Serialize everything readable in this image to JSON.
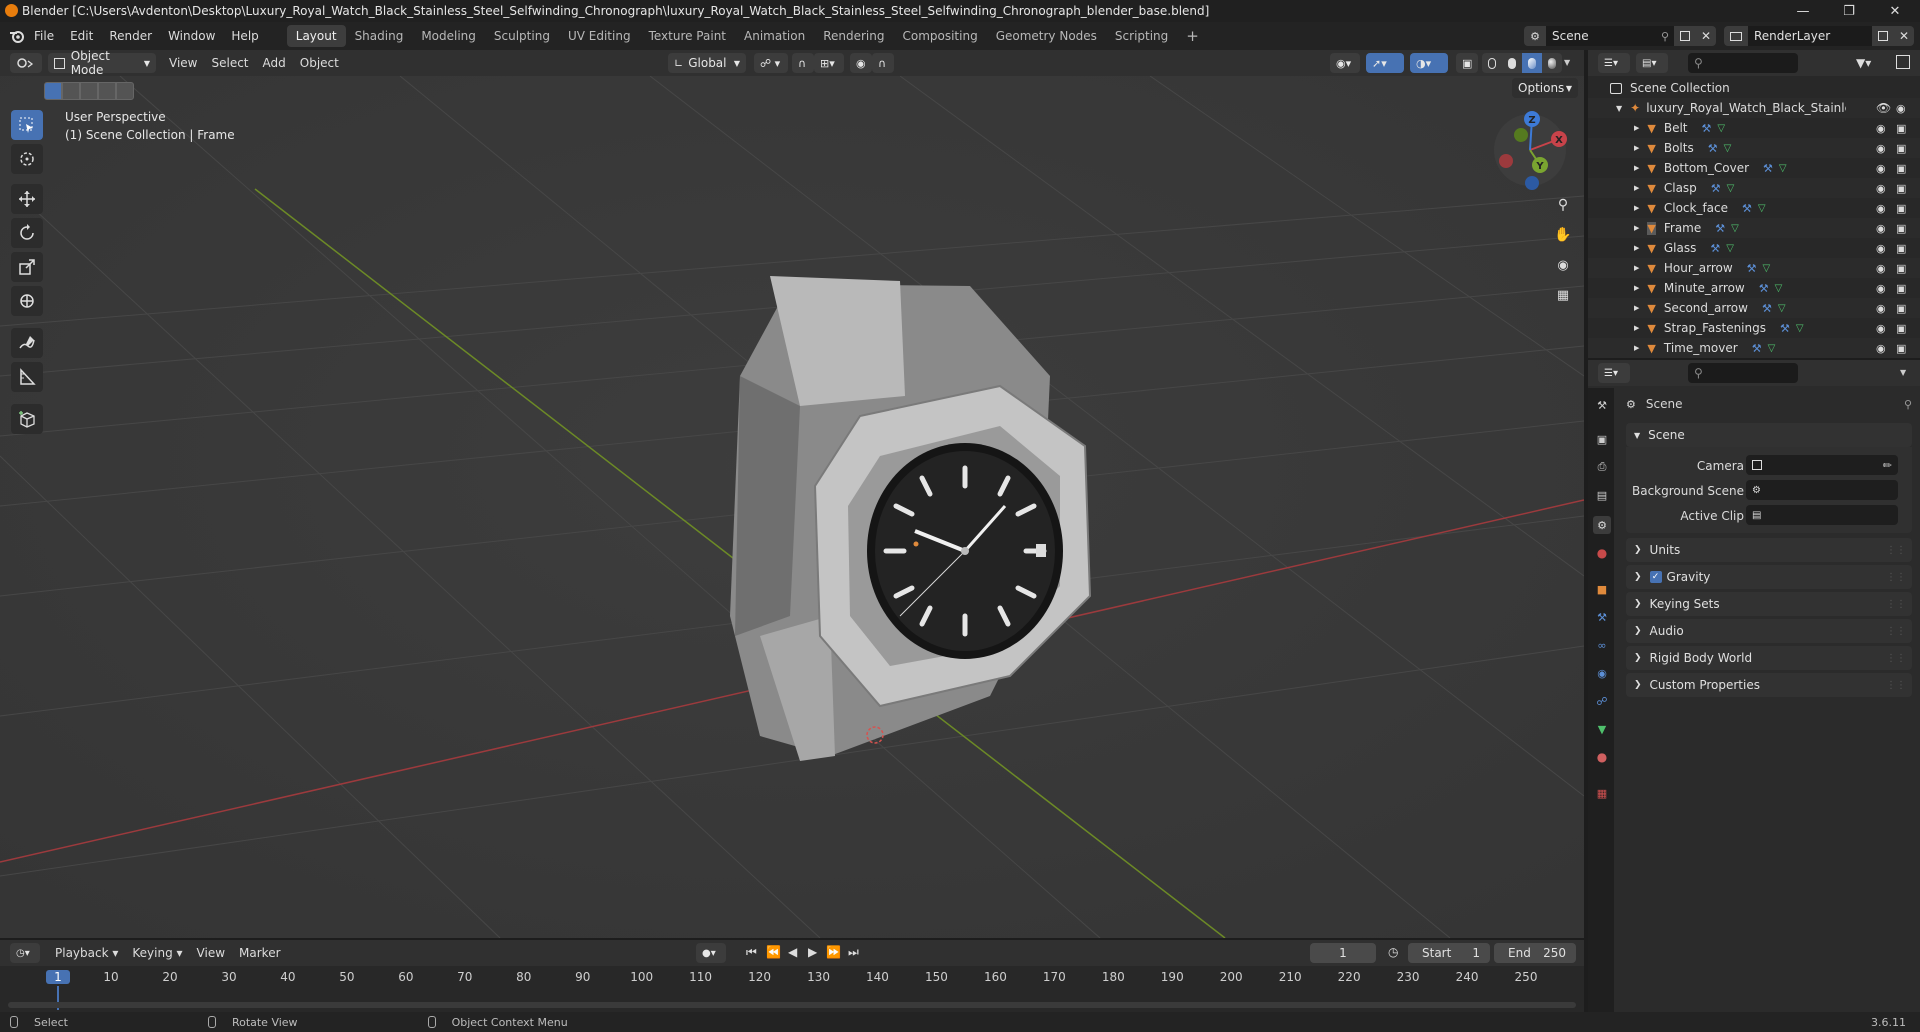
{
  "titlebar": {
    "title": "Blender [C:\\Users\\Avdenton\\Desktop\\Luxury_Royal_Watch_Black_Stainless_Steel_Selfwinding_Chronograph\\luxury_Royal_Watch_Black_Stainless_Steel_Selfwinding_Chronograph_blender_base.blend]"
  },
  "menu": [
    "File",
    "Edit",
    "Render",
    "Window",
    "Help"
  ],
  "workspaces": [
    "Layout",
    "Shading",
    "Modeling",
    "Sculpting",
    "UV Editing",
    "Texture Paint",
    "Animation",
    "Rendering",
    "Compositing",
    "Geometry Nodes",
    "Scripting"
  ],
  "active_workspace": "Layout",
  "scene_field": "Scene",
  "renderlayer_field": "RenderLayer",
  "viewport_header": {
    "mode": "Object Mode",
    "menus": [
      "View",
      "Select",
      "Add",
      "Object"
    ],
    "orientation": "Global",
    "options": "Options"
  },
  "viewport": {
    "perspective": "User Perspective",
    "collection_info": "(1) Scene Collection | Frame",
    "gizmo_axes": [
      "X",
      "Y",
      "Z"
    ]
  },
  "outliner": {
    "root": "Scene Collection",
    "collection": "luxury_Royal_Watch_Black_Stainless_St",
    "objects": [
      "Belt",
      "Bolts",
      "Bottom_Cover",
      "Clasp",
      "Clock_face",
      "Frame",
      "Glass",
      "Hour_arrow",
      "Minute_arrow",
      "Second_arrow",
      "Strap_Fastenings",
      "Time_mover"
    ]
  },
  "properties": {
    "header": "Scene",
    "panel_scene": "Scene",
    "fields": [
      {
        "label": "Camera",
        "value": ""
      },
      {
        "label": "Background Scene",
        "value": ""
      },
      {
        "label": "Active Clip",
        "value": ""
      }
    ],
    "panels": [
      "Units",
      "Gravity",
      "Keying Sets",
      "Audio",
      "Rigid Body World",
      "Custom Properties"
    ],
    "gravity_checked": true
  },
  "timeline": {
    "menus": [
      "Playback",
      "Keying",
      "View",
      "Marker"
    ],
    "current_frame": "1",
    "start_label": "Start",
    "start": "1",
    "end_label": "End",
    "end": "250",
    "ruler": [
      "1",
      "10",
      "20",
      "30",
      "40",
      "50",
      "60",
      "70",
      "80",
      "90",
      "100",
      "110",
      "120",
      "130",
      "140",
      "150",
      "160",
      "170",
      "180",
      "190",
      "200",
      "210",
      "220",
      "230",
      "240",
      "250"
    ]
  },
  "statusbar": {
    "items": [
      "Select",
      "Rotate View",
      "Object Context Menu"
    ],
    "version": "3.6.11"
  },
  "colors": {
    "accent": "#4772b3",
    "x_axis": "#c8434a",
    "y_axis": "#7aa530",
    "z_axis": "#3d7ad6",
    "object_orange": "#e08a3c"
  }
}
